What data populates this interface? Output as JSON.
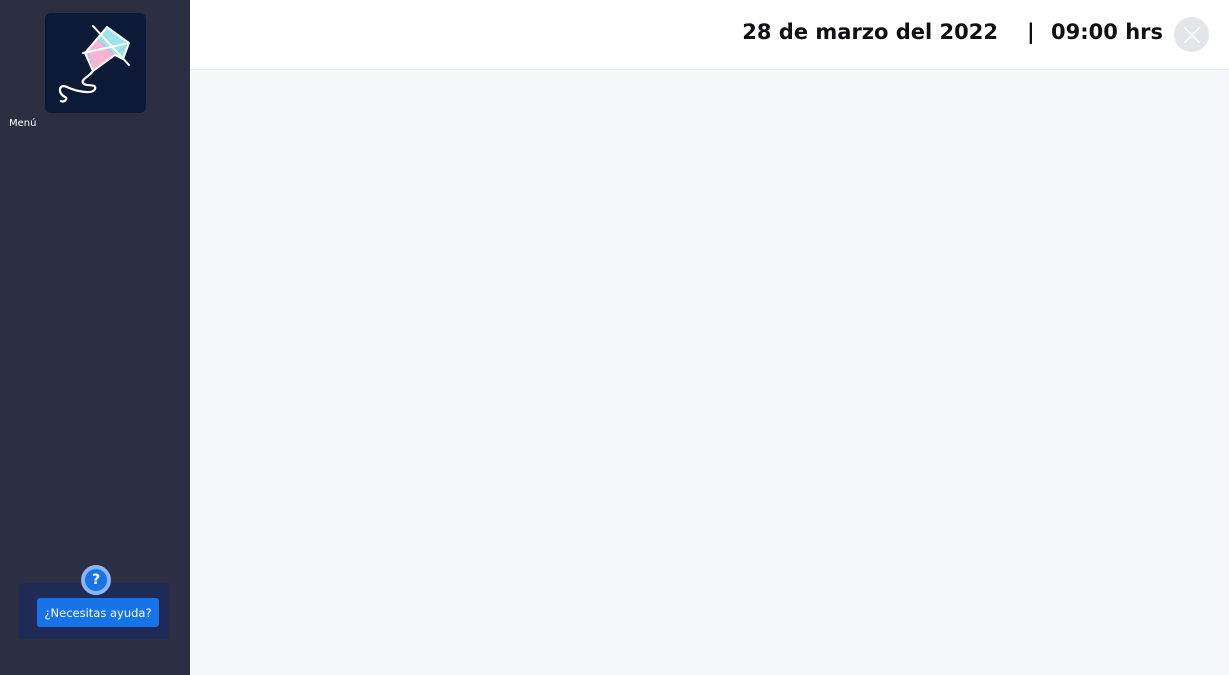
{
  "sidebar": {
    "logo_icon": "kite-icon",
    "menu_label": "Menú",
    "help": {
      "icon": "question-icon",
      "icon_glyph": "?",
      "button_label": "¿Necesitas ayuda?"
    }
  },
  "header": {
    "date": "28 de marzo del 2022",
    "separator": "|",
    "time": "09:00 hrs",
    "close_icon": "close-icon"
  },
  "colors": {
    "sidebar_bg": "#2c2f41",
    "logo_bg": "#0d1a36",
    "accent_blue": "#1673ea",
    "help_panel_bg": "#1f2a57",
    "main_bg": "#f5f7fb",
    "kite_pink": "#f2b6d2",
    "kite_cyan": "#9ee3ea"
  }
}
